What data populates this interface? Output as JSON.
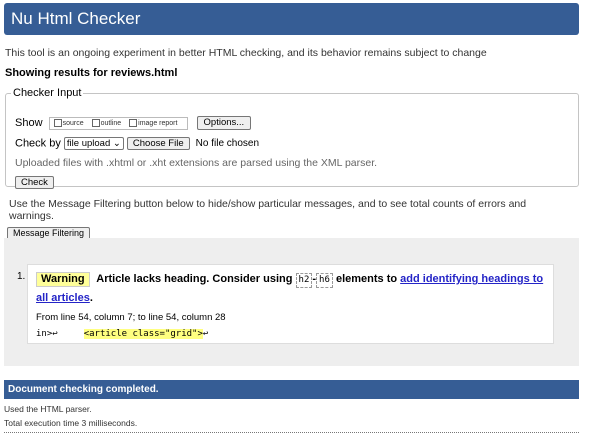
{
  "app": {
    "title": "Nu Html Checker"
  },
  "intro": "This tool is an ongoing experiment in better HTML checking, and its behavior remains subject to change",
  "results_for": "Showing results for reviews.html",
  "checker": {
    "legend": "Checker Input",
    "show_label": "Show",
    "show_options": [
      "source",
      "outline",
      "image report"
    ],
    "options_button": "Options...",
    "checkby_label": "Check by",
    "checkby_value": "file upload",
    "choose_file": "Choose File",
    "no_file": "No file chosen",
    "note": "Uploaded files with .xhtml or .xht extensions are parsed using the XML parser.",
    "check_button": "Check"
  },
  "filter_hint": "Use the Message Filtering button below to hide/show particular messages, and to see total counts of errors and warnings.",
  "filter_button": "Message Filtering",
  "messages": [
    {
      "num": "1.",
      "type": "Warning",
      "text_before": "Article lacks heading. Consider using",
      "code_a": "h2",
      "dash": "-",
      "code_b": "h6",
      "text_after": "elements to",
      "link": "add identifying headings to all articles",
      "period": ".",
      "location": "From line 54, column 7; to line 54, column 28",
      "extract_before": "in>↩",
      "extract_highlight": "<article class=\"grid\">",
      "extract_after": "↩"
    }
  ],
  "completed": "Document checking completed.",
  "footer": {
    "parser": "Used the HTML parser.",
    "time": "Total execution time 3 milliseconds."
  },
  "colors": {
    "brand": "#365d95",
    "warning_bg": "#ffff99",
    "link": "#2424c7"
  }
}
